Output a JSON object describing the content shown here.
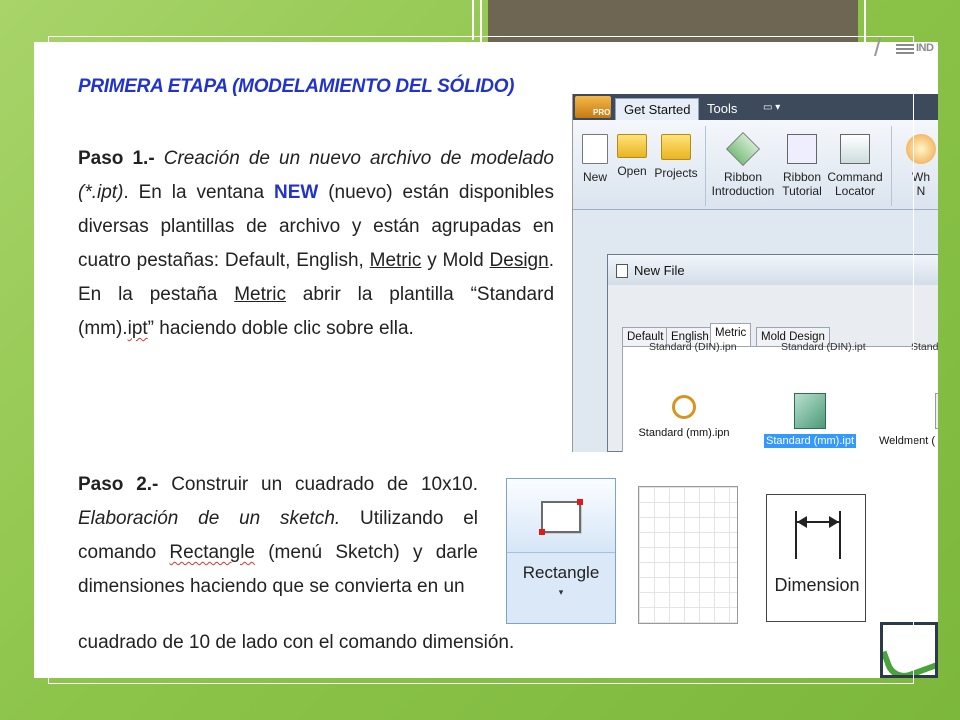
{
  "heading": "PRIMERA ETAPA (MODELAMIENTO DEL SÓLIDO)",
  "paso1": {
    "label": "Paso 1.-",
    "t1": " Creación de un nuevo archivo de modelado (*.ipt)",
    "t2": ". En la ventana ",
    "new_word": "NEW",
    "t3": " (nuevo) están disponibles diversas plantillas de archivo  y están agrupadas en cuatro ",
    "pestanas": "pestañas",
    "t4": ": Default, English, ",
    "metric": "Metric",
    "t5": " y Mold ",
    "design": "Design",
    "t6": ". En la ",
    "pestana": "pestaña",
    "t7": " ",
    "metric2": "Metric",
    "t8": " abrir la plantilla “Standard (mm).",
    "ipt": "ipt",
    "t9": "”  haciendo doble clic sobre ella."
  },
  "paso2": {
    "label": "Paso 2.-",
    "t1": "  Construir un cuadrado de 10x10. ",
    "t2": "Elaboración de un sketch.",
    "t3": " Utilizando el comando ",
    "rectangle": "Rectangle",
    "t4": " (menú Sketch) y darle dimensiones haciendo que se convierta en un",
    "t5": "cuadrado de 10 de lado con el comando dimensión."
  },
  "inventor": {
    "pro": "PRO",
    "tabs": [
      "Get Started",
      "Tools"
    ],
    "mini": "▭ ▾",
    "ribbon": [
      {
        "l1": "New",
        "l2": "",
        "icon": "new-file-icon"
      },
      {
        "l1": "Open",
        "l2": "",
        "icon": "open-folder-icon"
      },
      {
        "l1": "Projects",
        "l2": "",
        "icon": "projects-icon"
      },
      {
        "l1": "Ribbon",
        "l2": "Introduction",
        "icon": "ribbon-intro-icon"
      },
      {
        "l1": "Ribbon",
        "l2": "Tutorial",
        "icon": "ribbon-tutorial-icon"
      },
      {
        "l1": "Command",
        "l2": "Locator",
        "icon": "command-locator-icon"
      },
      {
        "l1": "Wh",
        "l2": "N",
        "icon": "whats-new-icon"
      }
    ],
    "new_file": {
      "title": "New File",
      "tabs": [
        "Default",
        "English",
        "Metric",
        "Mold Design"
      ],
      "cut_items": [
        "Standard (DIN).ipn",
        "Standard (DIN).ipt",
        "Standa"
      ],
      "items": [
        "Standard (mm).ipn",
        "Standard (mm).ipt",
        "Weldment ("
      ]
    }
  },
  "tools": {
    "rectangle": "Rectangle",
    "rectangle_arrow": "▾",
    "dimension": "Dimension"
  },
  "logo": {
    "slash": "/",
    "text": "IND"
  }
}
